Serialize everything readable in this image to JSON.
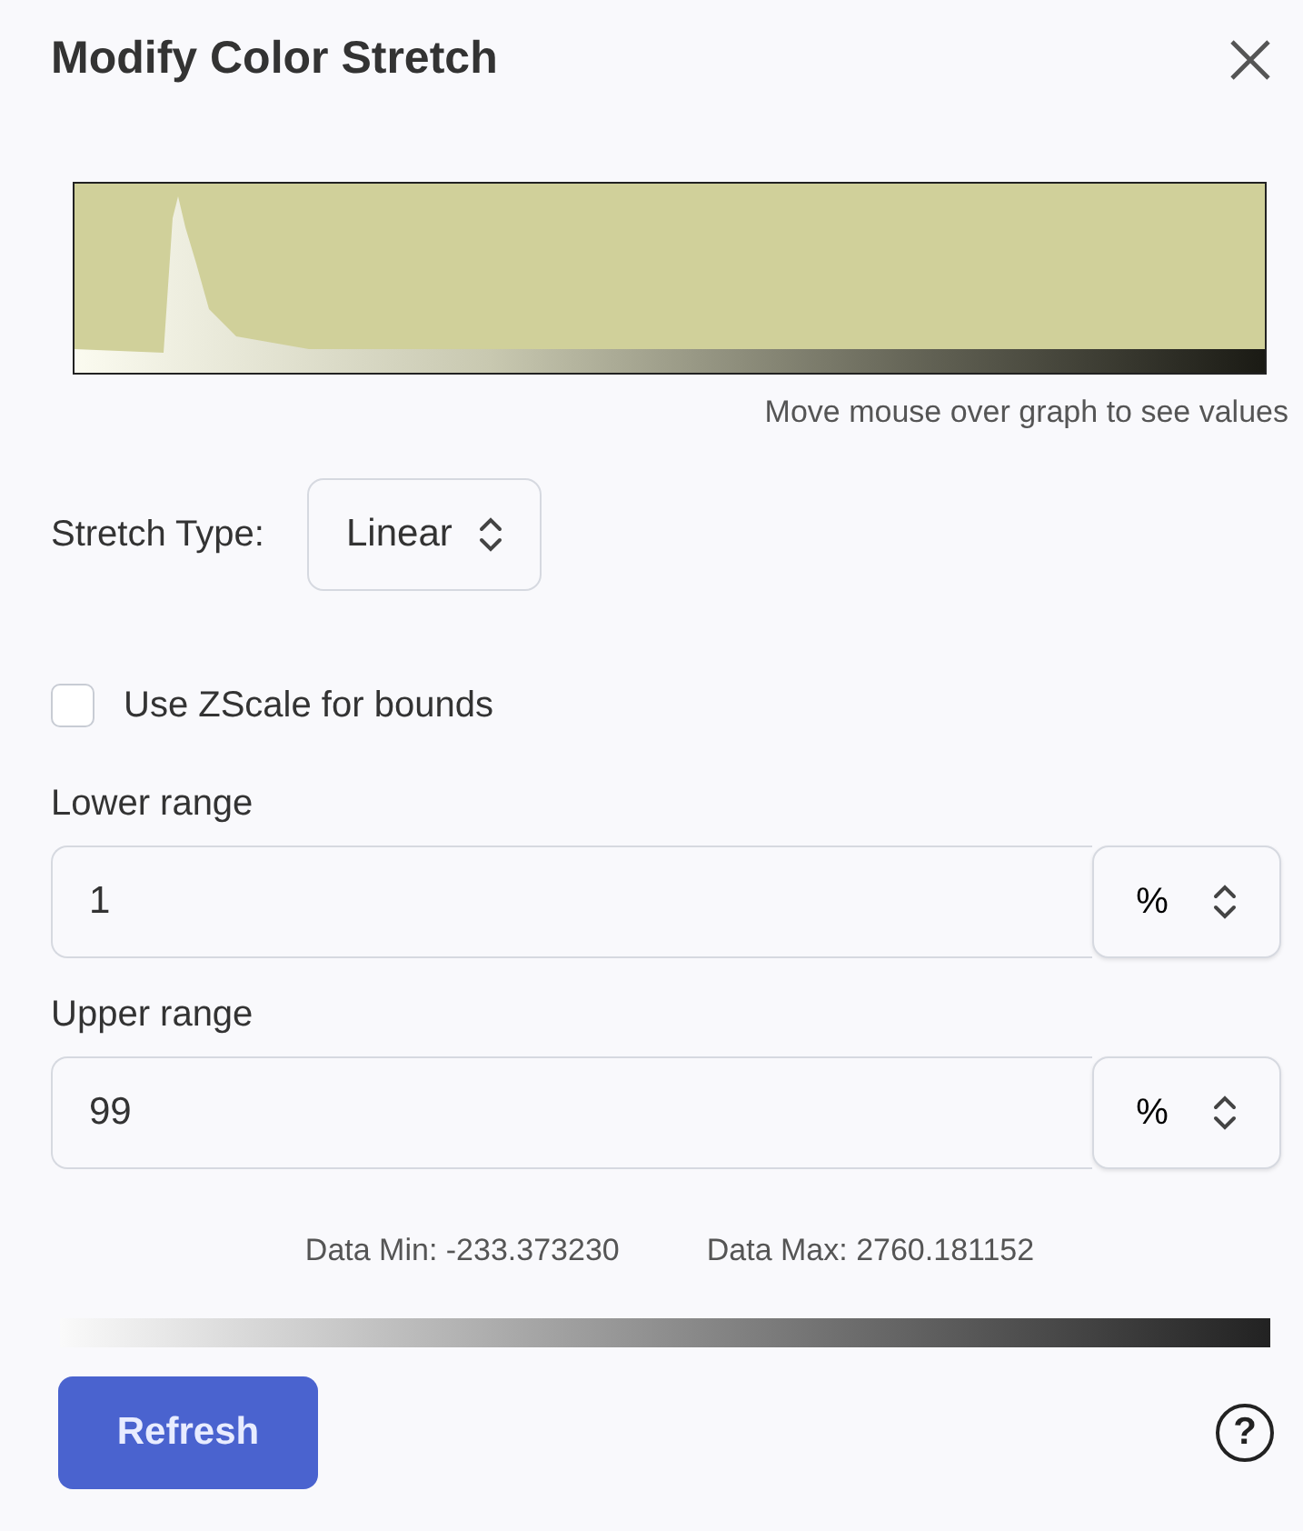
{
  "dialog": {
    "title": "Modify Color Stretch"
  },
  "histogram": {
    "kind": "picture",
    "caption": "Move mouse over graph to see values"
  },
  "stretch_type": {
    "label": "Stretch Type:",
    "value": "Linear"
  },
  "zscale": {
    "label": "Use ZScale for bounds",
    "checked": false
  },
  "ranges": [
    {
      "label": "Lower range",
      "value": "1",
      "unit": "%"
    },
    {
      "label": "Upper range",
      "value": "99",
      "unit": "%"
    }
  ],
  "data_stats": [
    "Data Min: -233.373230",
    "Data Max: 2760.181152"
  ],
  "buttons": [
    {
      "label": "Refresh"
    }
  ],
  "help": "?"
}
